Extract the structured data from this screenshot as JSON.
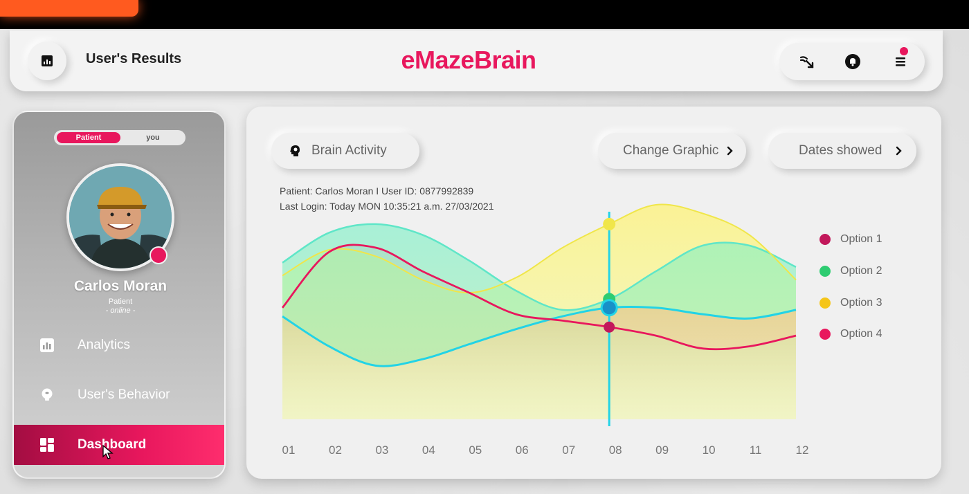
{
  "header": {
    "title": "User's Results",
    "brand": "eMazeBrain"
  },
  "sidebar": {
    "toggle": {
      "active": "Patient",
      "inactive": "you"
    },
    "profile": {
      "name": "Carlos Moran",
      "role": "Patient",
      "status": "- online -"
    },
    "items": [
      {
        "label": "Analytics",
        "icon": "bar-chart-icon"
      },
      {
        "label": "User's Behavior",
        "icon": "brain-bulb-icon"
      },
      {
        "label": "Dashboard",
        "icon": "dashboard-icon",
        "active": true
      }
    ]
  },
  "panel": {
    "brain_activity_label": "Brain Activity",
    "change_graphic_label": "Change Graphic",
    "dates_showed_label": "Dates showed",
    "patient_info": "Patient: Carlos Moran I User ID: 0877992839",
    "last_login": "Last Login: Today  MON 10:35:21 a.m. 27/03/2021"
  },
  "colors": {
    "accent": "#e8175d",
    "option1": "#c2185b",
    "option2": "#2ecc71",
    "option3": "#f5c518",
    "option4": "#e8175d",
    "cursor": "#22d3e6"
  },
  "chart_data": {
    "type": "area",
    "categories": [
      "01",
      "02",
      "03",
      "04",
      "05",
      "06",
      "07",
      "08",
      "09",
      "10",
      "11",
      "12"
    ],
    "highlighted_category": "08",
    "ylim": [
      0,
      10
    ],
    "grid": false,
    "legend": "right",
    "series": [
      {
        "name": "Option 1",
        "color": "#c2185b",
        "values": [
          5.2,
          7.8,
          8.0,
          6.9,
          5.9,
          4.9,
          4.6,
          4.3,
          3.9,
          3.3,
          3.4,
          3.9
        ]
      },
      {
        "name": "Option 2",
        "color": "#2ecc71",
        "values": [
          7.3,
          8.7,
          9.1,
          8.6,
          7.4,
          6.0,
          5.1,
          5.6,
          6.9,
          8.1,
          8.1,
          7.1
        ]
      },
      {
        "name": "Option 3",
        "color": "#f5c518",
        "values": [
          6.7,
          7.9,
          7.6,
          6.5,
          5.9,
          6.6,
          8.0,
          9.1,
          10.0,
          9.6,
          8.6,
          6.5
        ]
      },
      {
        "name": "Option 4",
        "color": "#e8175d",
        "values": [
          4.8,
          3.4,
          2.5,
          2.8,
          3.5,
          4.2,
          4.8,
          5.2,
          5.2,
          4.9,
          4.7,
          5.1
        ]
      }
    ]
  }
}
